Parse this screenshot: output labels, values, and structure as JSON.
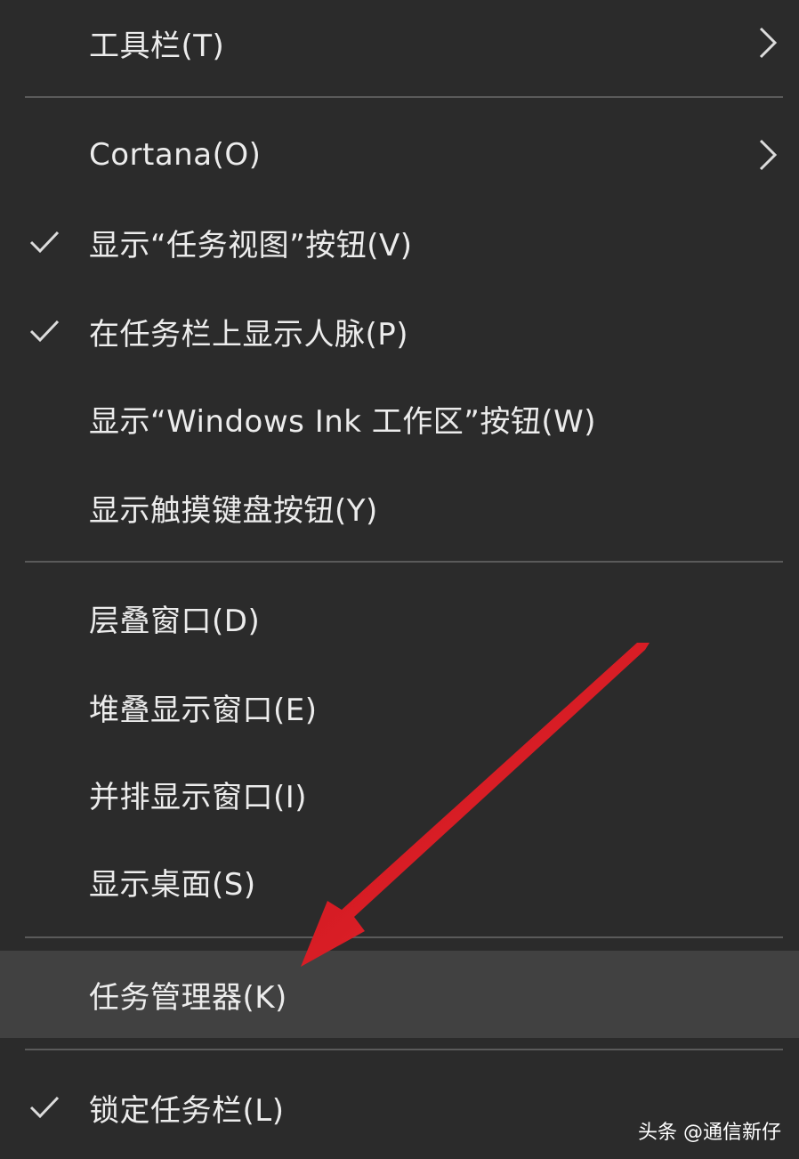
{
  "menu": {
    "items": [
      {
        "label": "工具栏(T)",
        "checked": false,
        "submenu": true
      },
      {
        "label": "Cortana(O)",
        "checked": false,
        "submenu": true
      },
      {
        "label": "显示“任务视图”按钮(V)",
        "checked": true,
        "submenu": false
      },
      {
        "label": "在任务栏上显示人脉(P)",
        "checked": true,
        "submenu": false
      },
      {
        "label": "显示“Windows Ink 工作区”按钮(W)",
        "checked": false,
        "submenu": false
      },
      {
        "label": "显示触摸键盘按钮(Y)",
        "checked": false,
        "submenu": false
      },
      {
        "label": "层叠窗口(D)",
        "checked": false,
        "submenu": false
      },
      {
        "label": "堆叠显示窗口(E)",
        "checked": false,
        "submenu": false
      },
      {
        "label": "并排显示窗口(I)",
        "checked": false,
        "submenu": false
      },
      {
        "label": "显示桌面(S)",
        "checked": false,
        "submenu": false
      },
      {
        "label": "任务管理器(K)",
        "checked": false,
        "submenu": false,
        "highlighted": true
      },
      {
        "label": "锁定任务栏(L)",
        "checked": true,
        "submenu": false
      }
    ]
  },
  "watermark": {
    "text": "头条 @通信新仔"
  },
  "colors": {
    "background": "#2b2b2b",
    "highlight": "#414141",
    "separator": "#5a5a5a",
    "text": "#ececec",
    "arrow": "#e8202a"
  },
  "icons": {
    "check": "check-icon",
    "submenu": "chevron-right-icon",
    "annotation": "red-arrow-annotation"
  }
}
